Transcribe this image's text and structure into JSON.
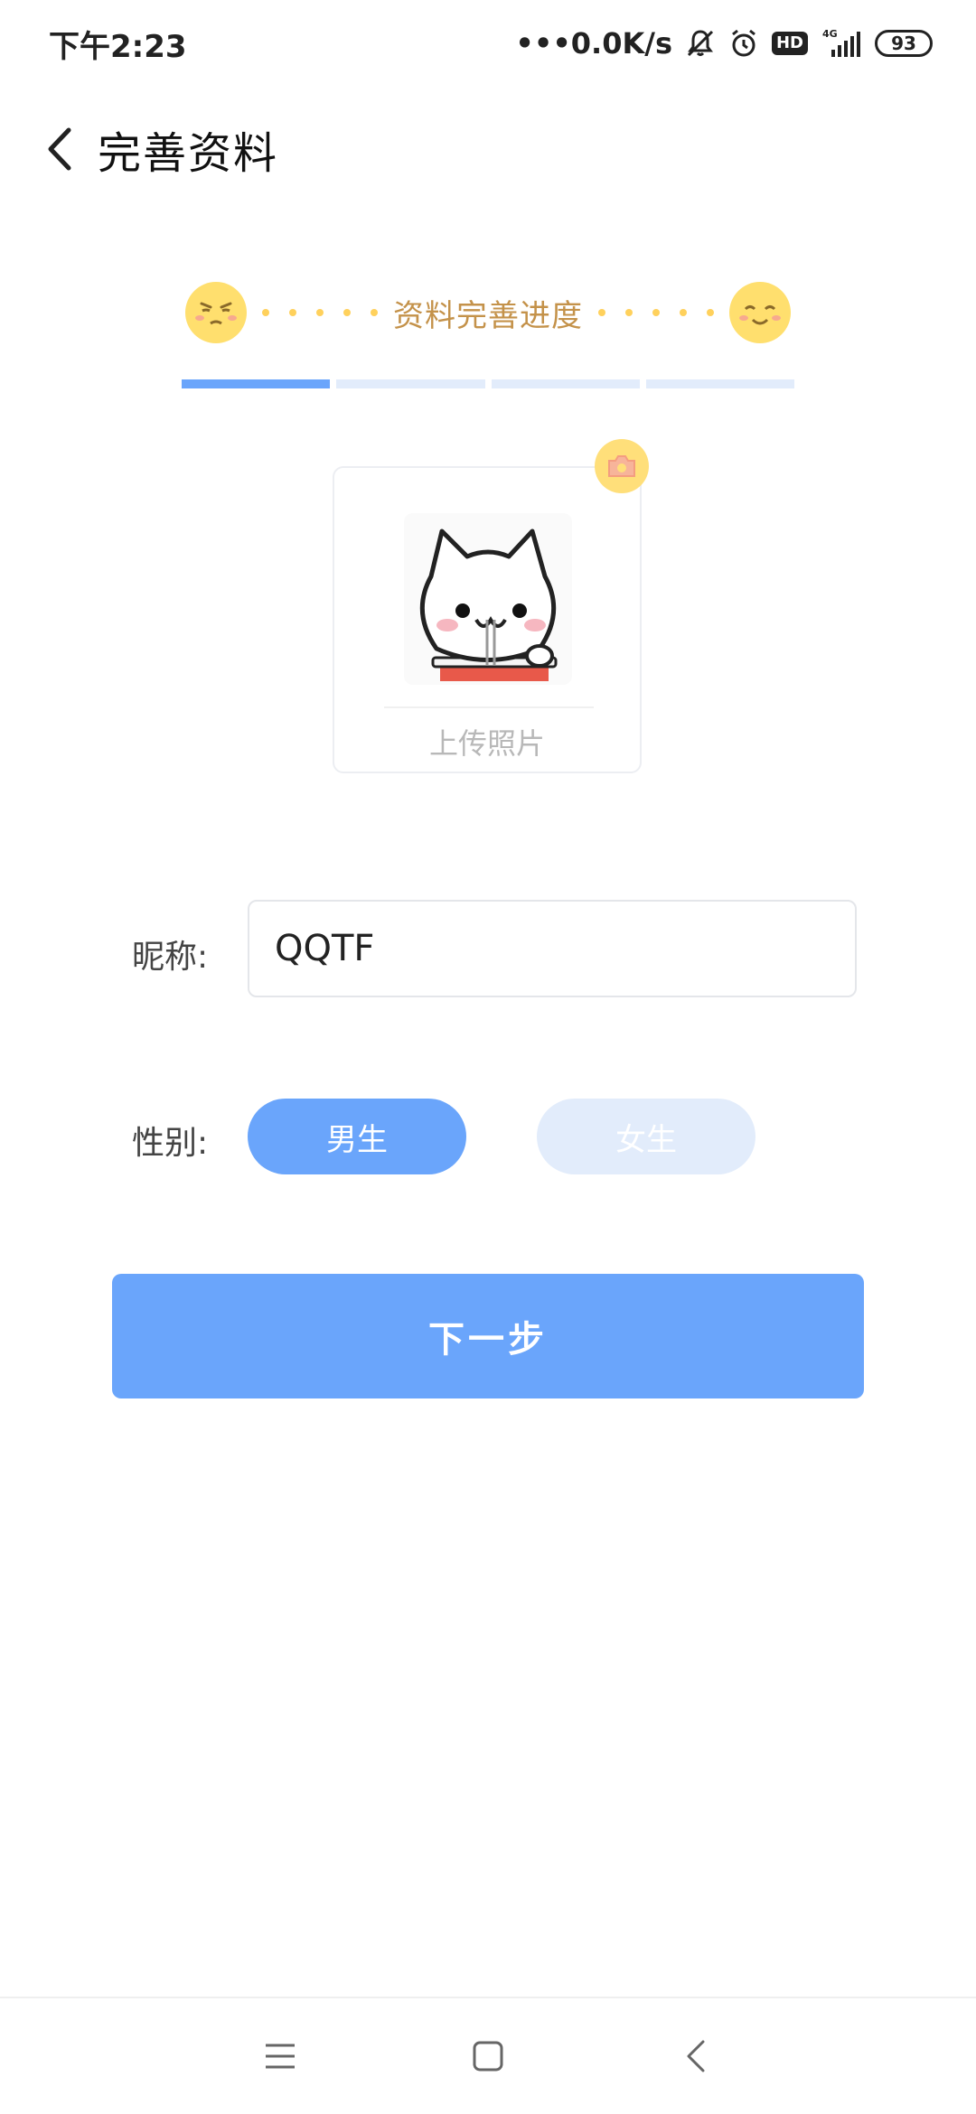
{
  "status_bar": {
    "time": "下午2:23",
    "network_speed": "•••0.0K/s",
    "hd_badge": "HD",
    "signal_label": "4G",
    "battery": "93"
  },
  "header": {
    "title": "完善资料",
    "back_icon": "chevron-left-icon"
  },
  "progress": {
    "label": "资料完善进度",
    "total_steps": 4,
    "current_step": 1,
    "start_icon": "sad-face-icon",
    "end_icon": "happy-face-icon"
  },
  "photo": {
    "upload_label": "上传照片",
    "camera_icon": "camera-icon",
    "avatar_icon": "cat-avatar-icon"
  },
  "form": {
    "nickname_label": "昵称:",
    "nickname_value": "QQTF",
    "gender_label": "性别:",
    "gender_male": "男生",
    "gender_female": "女生",
    "gender_selected": "男生"
  },
  "actions": {
    "next_label": "下一步"
  },
  "nav_bar": {
    "menu_icon": "menu-icon",
    "home_icon": "home-square-icon",
    "back_icon": "back-arrow-icon"
  },
  "colors": {
    "accent": "#6aa5fb",
    "accent_light": "#e2ecfb",
    "yellow": "#ffdf6e",
    "progress_text": "#c4924a"
  }
}
